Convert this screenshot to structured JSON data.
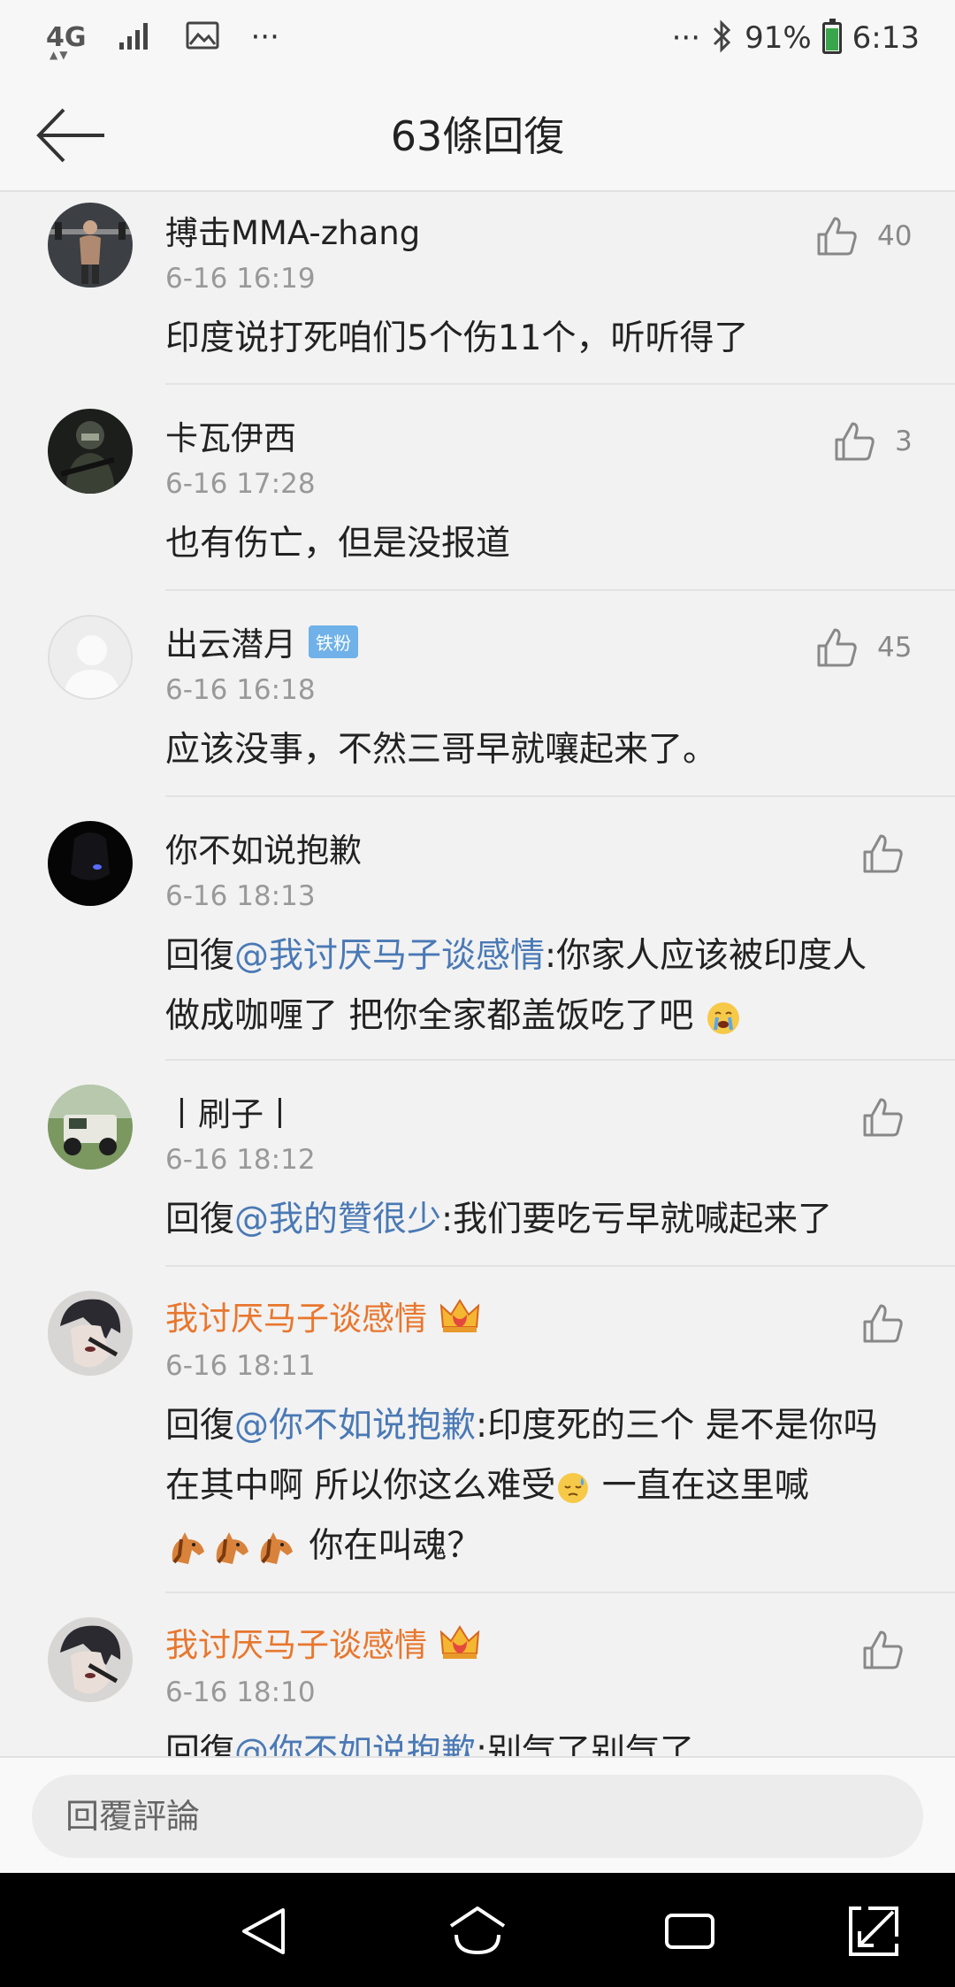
{
  "status_bar": {
    "network": "4G",
    "dots_left": "···",
    "dots_right": "···",
    "battery": "91%",
    "time": "6:13"
  },
  "header": {
    "title": "63條回復"
  },
  "comments": [
    {
      "user": "搏击MMA-zhang",
      "time": "6-16 16:19",
      "likes": "40",
      "text": "印度说打死咱们5个伤11个，听听得了"
    },
    {
      "user": "卡瓦伊西",
      "time": "6-16 17:28",
      "likes": "3",
      "text": "也有伤亡，但是没报道"
    },
    {
      "user": "出云潜月",
      "badge": "铁粉",
      "time": "6-16 16:18",
      "likes": "45",
      "text": "应该没事，不然三哥早就嚷起来了。"
    },
    {
      "user": "你不如说抱歉",
      "time": "6-16 18:13",
      "reply_prefix": "回復",
      "mention": "@我讨厌马子谈感情",
      "text": ":你家人应该被印度人做成咖喱了 把你全家都盖饭吃了吧"
    },
    {
      "user": "丨刷子丨",
      "time": "6-16 18:12",
      "reply_prefix": "回復",
      "mention": "@我的贊很少",
      "text": ":我们要吃亏早就喊起来了"
    },
    {
      "user": "我讨厌马子谈感情",
      "time": "6-16 18:11",
      "reply_prefix": "回復",
      "mention": "@你不如说抱歉",
      "text": ":印度死的三个 是不是你吗在其中啊 所以你这么难受",
      "text2": " 一直在这里喊",
      "text3": " 你在叫魂？"
    },
    {
      "user": "我讨厌马子谈感情",
      "time": "6-16 18:10",
      "reply_prefix": "回復",
      "mention": "@你不如说抱歉",
      "text": ":别气了别气了"
    }
  ],
  "reply_bar": {
    "placeholder": "回覆評論"
  },
  "colors": {
    "accent_link": "#4a79b5",
    "vip_name": "#e8772e",
    "fan_badge": "#6fb1e8"
  }
}
